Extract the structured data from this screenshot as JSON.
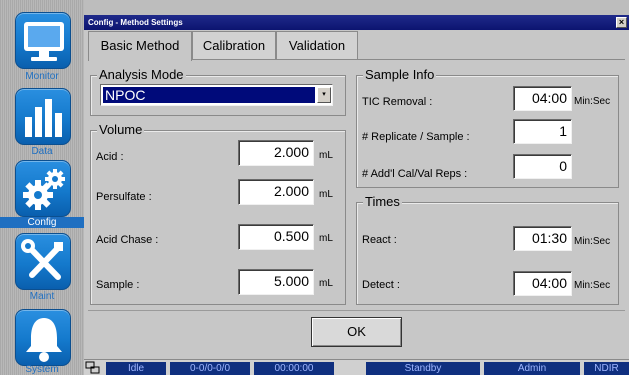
{
  "nav": {
    "items": [
      {
        "key": "monitor",
        "label": "Monitor",
        "icon": "monitor-icon",
        "active": false
      },
      {
        "key": "data",
        "label": "Data",
        "icon": "bar-chart-icon",
        "active": false
      },
      {
        "key": "config",
        "label": "Config",
        "icon": "gears-icon",
        "active": true
      },
      {
        "key": "maint",
        "label": "Maint",
        "icon": "tools-icon",
        "active": false
      },
      {
        "key": "system",
        "label": "System",
        "icon": "bell-icon",
        "active": false
      }
    ]
  },
  "window": {
    "title": "Config - Method Settings",
    "close_label": "×"
  },
  "tabs": [
    {
      "label": "Basic Method",
      "active": true
    },
    {
      "label": "Calibration",
      "active": false
    },
    {
      "label": "Validation",
      "active": false
    }
  ],
  "analysis_mode": {
    "title": "Analysis Mode",
    "value": "NPOC",
    "dropdown_glyph": "▾"
  },
  "volume": {
    "title": "Volume",
    "rows": [
      {
        "label": "Acid :",
        "value": "2.000",
        "unit": "mL"
      },
      {
        "label": "Persulfate :",
        "value": "2.000",
        "unit": "mL"
      },
      {
        "label": "Acid Chase :",
        "value": "0.500",
        "unit": "mL"
      },
      {
        "label": "Sample :",
        "value": "5.000",
        "unit": "mL"
      }
    ]
  },
  "sample_info": {
    "title": "Sample Info",
    "rows": [
      {
        "label": "TIC Removal :",
        "value": "04:00",
        "unit": "Min:Sec"
      },
      {
        "label": "# Replicate / Sample :",
        "value": "1",
        "unit": ""
      },
      {
        "label": "# Add'l Cal/Val Reps :",
        "value": "0",
        "unit": ""
      }
    ]
  },
  "times": {
    "title": "Times",
    "rows": [
      {
        "label": "React :",
        "value": "01:30",
        "unit": "Min:Sec"
      },
      {
        "label": "Detect :",
        "value": "04:00",
        "unit": "Min:Sec"
      }
    ]
  },
  "ok_label": "OK",
  "status": {
    "cells": [
      "Idle",
      "0-0/0-0/0",
      "00:00:00",
      "Standby",
      "Admin",
      "NDIR"
    ]
  },
  "colors": {
    "accent": "#1479cc",
    "title_bar": "#0c1470",
    "status_cell": "#0f2f7f",
    "selection": "#000a7a"
  }
}
